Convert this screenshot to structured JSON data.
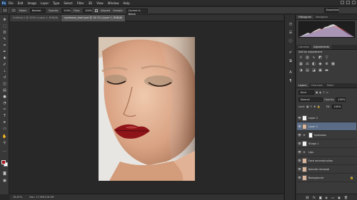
{
  "menubar": {
    "logo": "Ps",
    "items": [
      "File",
      "Edit",
      "Image",
      "Layer",
      "Type",
      "Select",
      "Filter",
      "3D",
      "View",
      "Window",
      "Help"
    ]
  },
  "options": {
    "mode_label": "Mode:",
    "mode_value": "Normal",
    "opacity_label": "Opacity:",
    "opacity_value": "100%",
    "flow_label": "Flow:",
    "flow_value": "100%",
    "aligned_label": "Aligned",
    "sample_label": "Sample:",
    "sample_value": "Current & Below",
    "workspace": "Essentials"
  },
  "tabs": [
    {
      "label": "Untitled-1 @ 100% (Layer 1, RGB/8)",
      "active": false
    },
    {
      "label": "eyebrows_start.psd @ 16.7% (Layer 1, RGB/8)",
      "active": true
    }
  ],
  "status": {
    "zoom": "16.67%",
    "doc": "Doc: 17.9M/126.3M"
  },
  "panels": {
    "histogram_tabs": [
      "Histogram",
      "Navigator"
    ],
    "adjust_tabs": [
      "Libraries",
      "Adjustments"
    ],
    "adjust_title": "Add an adjustment",
    "layers_tabs": [
      "Layers",
      "Channels",
      "Paths"
    ],
    "kind_label": "Kind",
    "blend_mode": "Normal",
    "opacity_label": "Opacity:",
    "opacity_value": "100%",
    "lock_label": "Lock:",
    "fill_label": "Fill:",
    "fill_value": "100%"
  },
  "layers": [
    {
      "name": "Layer 2",
      "thumb": "white",
      "selected": false
    },
    {
      "name": "Layer 1",
      "thumb": "face",
      "selected": true
    },
    {
      "name": "eyebrows",
      "thumb": "group",
      "selected": false
    },
    {
      "name": "Shape 1",
      "thumb": "white",
      "selected": false
    },
    {
      "name": "Lips",
      "thumb": "group",
      "selected": false
    },
    {
      "name": "Face reconstruction",
      "thumb": "face",
      "selected": false
    },
    {
      "name": "blemish removal",
      "thumb": "face",
      "selected": false
    },
    {
      "name": "Background",
      "thumb": "face",
      "selected": false
    }
  ],
  "colors": {
    "foreground": "#b1101d",
    "background": "#ffffff",
    "selected_layer": "#5b6d86"
  }
}
